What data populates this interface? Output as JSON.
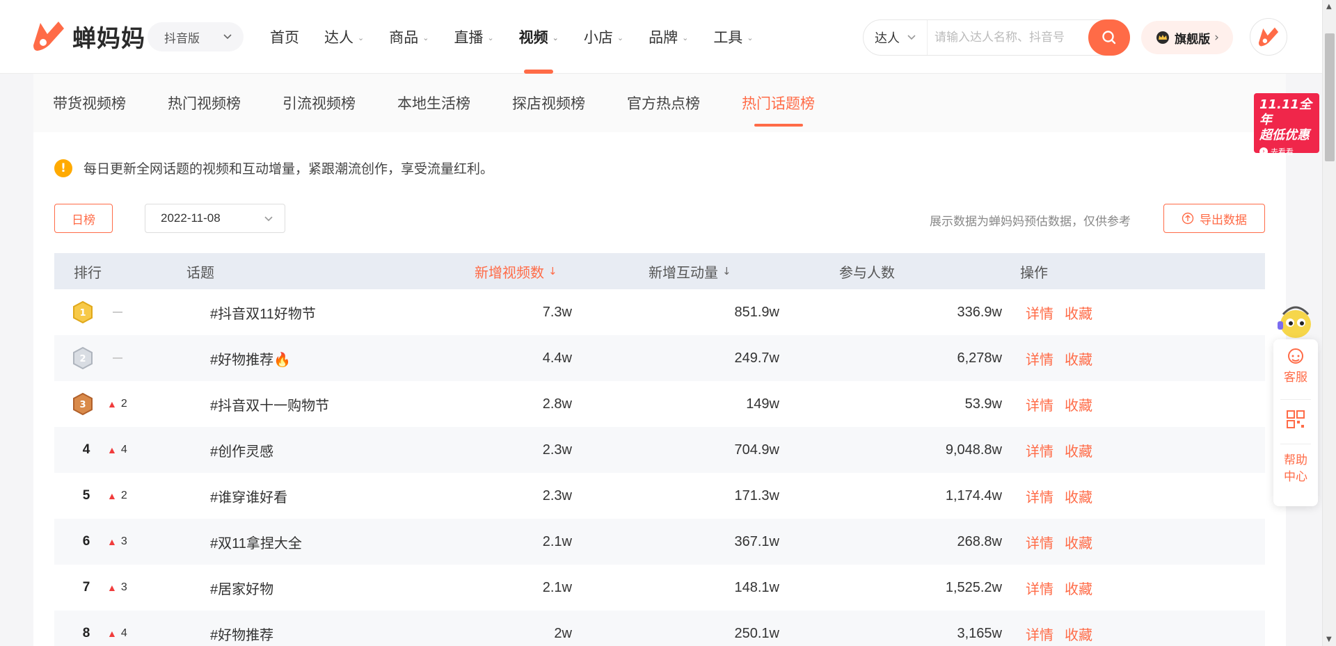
{
  "header": {
    "brand": "蝉妈妈",
    "platform": "抖音版",
    "nav": [
      {
        "label": "首页",
        "caret": false,
        "active": false
      },
      {
        "label": "达人",
        "caret": true,
        "active": false
      },
      {
        "label": "商品",
        "caret": true,
        "active": false
      },
      {
        "label": "直播",
        "caret": true,
        "active": false
      },
      {
        "label": "视频",
        "caret": true,
        "active": true
      },
      {
        "label": "小店",
        "caret": true,
        "active": false
      },
      {
        "label": "品牌",
        "caret": true,
        "active": false
      },
      {
        "label": "工具",
        "caret": true,
        "active": false
      }
    ],
    "search_type": "达人",
    "search_placeholder": "请输入达人名称、抖音号",
    "flagship": "旗舰版"
  },
  "subtabs": [
    {
      "label": "带货视频榜",
      "active": false
    },
    {
      "label": "热门视频榜",
      "active": false
    },
    {
      "label": "引流视频榜",
      "active": false
    },
    {
      "label": "本地生活榜",
      "active": false
    },
    {
      "label": "探店视频榜",
      "active": false
    },
    {
      "label": "官方热点榜",
      "active": false
    },
    {
      "label": "热门话题榜",
      "active": true
    }
  ],
  "notice": "每日更新全网话题的视频和互动增量，紧跟潮流创作，享受流量红利。",
  "filters": {
    "period": "日榜",
    "date": "2022-11-08",
    "data_note": "展示数据为蝉妈妈预估数据，仅供参考",
    "export": "导出数据"
  },
  "table": {
    "headers": {
      "rank": "排行",
      "topic": "话题",
      "new_videos": "新增视频数",
      "new_interactions": "新增互动量",
      "participants": "参与人数",
      "actions": "操作"
    },
    "rows": [
      {
        "rank": "1",
        "medal": "gold",
        "change": "",
        "trend": "flat",
        "topic": "#抖音双11好物节",
        "new_videos": "7.3w",
        "new_interactions": "851.9w",
        "participants": "336.9w"
      },
      {
        "rank": "2",
        "medal": "silver",
        "change": "",
        "trend": "flat",
        "topic": "#好物推荐🔥",
        "new_videos": "4.4w",
        "new_interactions": "249.7w",
        "participants": "6,278w"
      },
      {
        "rank": "3",
        "medal": "bronze",
        "change": "2",
        "trend": "up",
        "topic": "#抖音双十一购物节",
        "new_videos": "2.8w",
        "new_interactions": "149w",
        "participants": "53.9w"
      },
      {
        "rank": "4",
        "medal": "",
        "change": "4",
        "trend": "up",
        "topic": "#创作灵感",
        "new_videos": "2.3w",
        "new_interactions": "704.9w",
        "participants": "9,048.8w"
      },
      {
        "rank": "5",
        "medal": "",
        "change": "2",
        "trend": "up",
        "topic": "#谁穿谁好看",
        "new_videos": "2.3w",
        "new_interactions": "171.3w",
        "participants": "1,174.4w"
      },
      {
        "rank": "6",
        "medal": "",
        "change": "3",
        "trend": "up",
        "topic": "#双11拿捏大全",
        "new_videos": "2.1w",
        "new_interactions": "367.1w",
        "participants": "268.8w"
      },
      {
        "rank": "7",
        "medal": "",
        "change": "3",
        "trend": "up",
        "topic": "#居家好物",
        "new_videos": "2.1w",
        "new_interactions": "148.1w",
        "participants": "1,525.2w"
      },
      {
        "rank": "8",
        "medal": "",
        "change": "4",
        "trend": "up",
        "topic": "#好物推荐",
        "new_videos": "2w",
        "new_interactions": "250.1w",
        "participants": "3,165w"
      }
    ],
    "action_detail": "详情",
    "action_collect": "收藏"
  },
  "promo": {
    "line1": "11.11全年",
    "line2": "超低优惠",
    "line3": "去看看"
  },
  "side": {
    "service": "客服",
    "help": "帮助中心"
  },
  "colors": {
    "accent": "#ff6b47",
    "header_bg": "#e8ecf3",
    "up": "#f03c3c",
    "warn": "#ffaa00"
  }
}
